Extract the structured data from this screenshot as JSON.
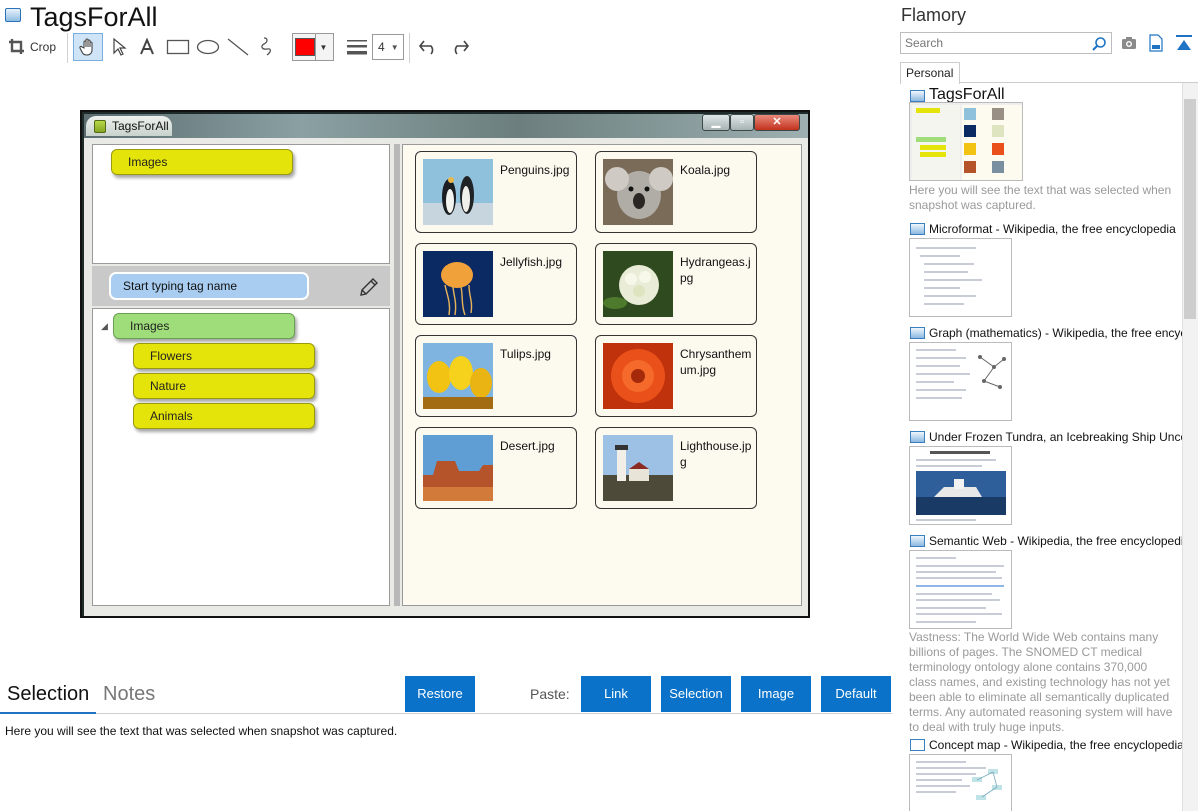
{
  "app": {
    "title": "TagsForAll"
  },
  "toolbar": {
    "crop_label": "Crop",
    "line_width_value": "4",
    "color": "#ff0000"
  },
  "snapshot": {
    "window_title": "TagsForAll",
    "top_tag": "Images",
    "tag_input_placeholder": "Start typing tag name",
    "tree": {
      "root": "Images",
      "children": [
        "Flowers",
        "Nature",
        "Animals"
      ]
    },
    "images": [
      {
        "name": "Penguins.jpg"
      },
      {
        "name": "Koala.jpg"
      },
      {
        "name": "Jellyfish.jpg"
      },
      {
        "name": "Hydrangeas.jpg"
      },
      {
        "name": "Tulips.jpg"
      },
      {
        "name": "Chrysanthemum.jpg"
      },
      {
        "name": "Desert.jpg"
      },
      {
        "name": "Lighthouse.jpg"
      }
    ]
  },
  "bottom": {
    "tab_selection": "Selection",
    "tab_notes": "Notes",
    "restore_label": "Restore",
    "paste_label": "Paste:",
    "paste_buttons": [
      "Link",
      "Selection",
      "Image",
      "Default"
    ],
    "selection_text": "Here you will see the text that was selected when snapshot was captured.",
    "accent": "#0a73c9"
  },
  "sidebar": {
    "title": "Flamory",
    "search_placeholder": "Search",
    "tab_personal": "Personal",
    "items": [
      {
        "title": "TagsForAll",
        "desc": "Here you will see the text that was selected when snapshot was captured."
      },
      {
        "title": "Microformat - Wikipedia, the free encyclopedia",
        "desc": ""
      },
      {
        "title": "Graph (mathematics) - Wikipedia, the free encyclopedia",
        "desc": ""
      },
      {
        "title": "Under Frozen Tundra, an Icebreaking Ship Uncovers",
        "desc": ""
      },
      {
        "title": "Semantic Web - Wikipedia, the free encyclopedia",
        "desc": "Vastness: The World Wide Web contains many billions of pages. The SNOMED CT medical terminology ontology alone contains 370,000 class names, and existing technology has not yet been able to eliminate all semantically duplicated terms. Any automated reasoning system will have to deal with truly huge inputs."
      },
      {
        "title": "Concept map - Wikipedia, the free encyclopedia",
        "desc": ""
      }
    ]
  }
}
